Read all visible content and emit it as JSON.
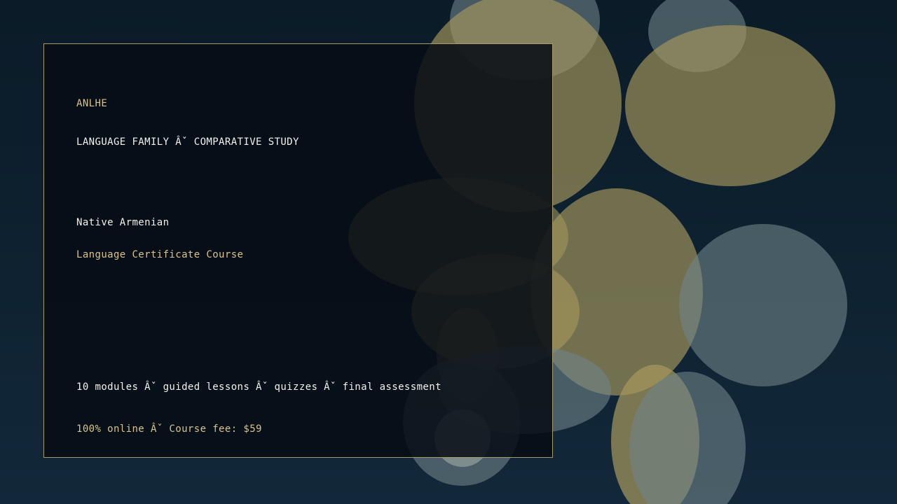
{
  "brand": "ANLHE",
  "kicker": "LANGUAGE FAMILY Âˇ COMPARATIVE STUDY",
  "course": {
    "title": "Native Armenian",
    "subtitle": "Language Certificate Course"
  },
  "features": "10 modules Âˇ guided lessons Âˇ quizzes Âˇ final assessment",
  "pricing": "100% online Âˇ Course fee: $59",
  "colors": {
    "background": "#0e2231",
    "accent_gold": "#d8c48c",
    "text_white": "#f2f2ee",
    "card_border": "#a69a66",
    "bokeh_gold": "#a89a5e",
    "bokeh_slate": "#6f8488"
  }
}
